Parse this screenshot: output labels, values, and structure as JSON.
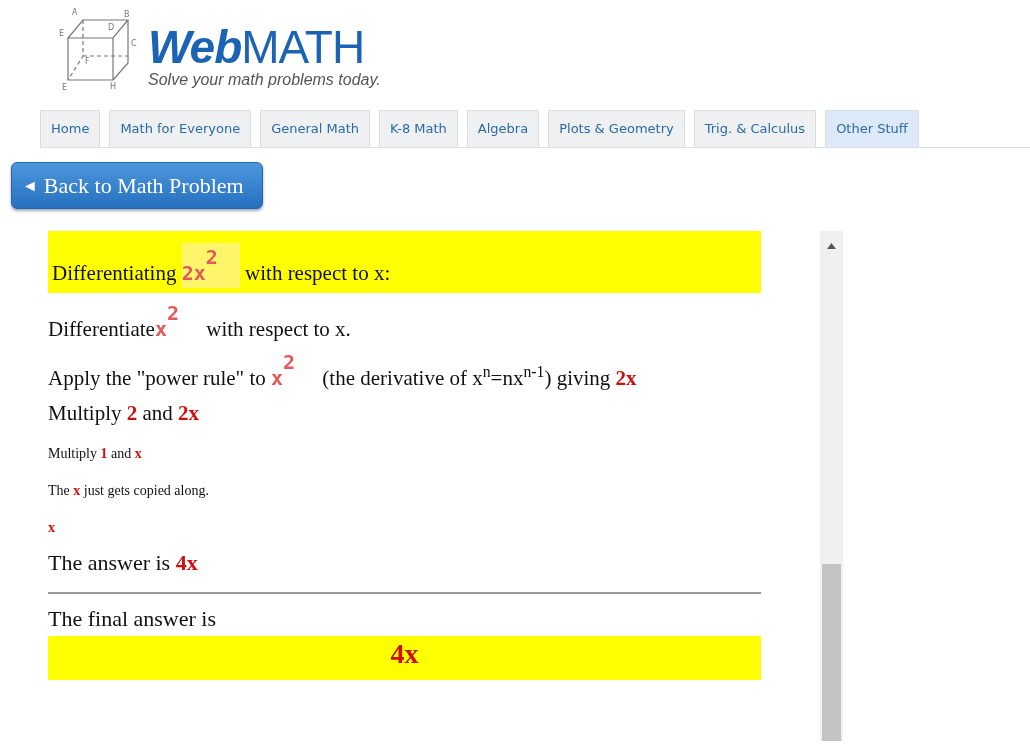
{
  "logo": {
    "vertex_labels": [
      "A",
      "B",
      "E",
      "D",
      "C",
      "F",
      "E",
      "H"
    ],
    "title_italic": "Web",
    "title_upright": "MATH",
    "tagline": "Solve your math problems today."
  },
  "tabs": [
    {
      "label": "Home",
      "selected": false
    },
    {
      "label": "Math for Everyone",
      "selected": false
    },
    {
      "label": "General Math",
      "selected": false
    },
    {
      "label": "K-8 Math",
      "selected": false
    },
    {
      "label": "Algebra",
      "selected": false
    },
    {
      "label": "Plots & Geometry",
      "selected": false
    },
    {
      "label": "Trig. & Calculus",
      "selected": false
    },
    {
      "label": "Other Stuff",
      "selected": true
    }
  ],
  "back_button": {
    "arrow": "◄",
    "label": "Back to Math Problem"
  },
  "steps": [
    {
      "kind": "header",
      "segments": [
        {
          "kind": "text",
          "text": "Differentiating "
        },
        {
          "kind": "expression",
          "text": "2x",
          "exponent": "2"
        },
        {
          "kind": "text",
          "text": " with respect to x:"
        }
      ]
    },
    {
      "kind": "line",
      "segments": [
        {
          "kind": "text",
          "text": "Differentiate"
        },
        {
          "kind": "expression",
          "text": "x",
          "exponent": "2"
        },
        {
          "kind": "text",
          "text": " with respect to x."
        }
      ]
    },
    {
      "kind": "line",
      "segments": [
        {
          "kind": "text",
          "text": "Apply the \"power rule\" to "
        },
        {
          "kind": "expression",
          "text": "x",
          "exponent": "2"
        },
        {
          "kind": "text",
          "text": " (the derivative of x$^{n}$=nx$^{n-1}$) giving "
        },
        {
          "kind": "term",
          "text": "2x"
        }
      ]
    },
    {
      "kind": "line",
      "segments": [
        {
          "kind": "text",
          "text": "Multiply "
        },
        {
          "kind": "term",
          "text": "2"
        },
        {
          "kind": "text",
          "text": " and "
        },
        {
          "kind": "term",
          "text": "2x"
        }
      ]
    },
    {
      "kind": "small",
      "segments": [
        {
          "kind": "text",
          "text": "Multiply "
        },
        {
          "kind": "term",
          "text": "1"
        },
        {
          "kind": "text",
          "text": " and "
        },
        {
          "kind": "term",
          "text": "x"
        }
      ]
    },
    {
      "kind": "small",
      "segments": [
        {
          "kind": "text",
          "text": "The "
        },
        {
          "kind": "term",
          "text": "x"
        },
        {
          "kind": "text",
          "text": " just gets copied along."
        }
      ]
    },
    {
      "kind": "small",
      "segments": [
        {
          "kind": "term",
          "text": "x"
        }
      ]
    },
    {
      "kind": "answer",
      "segments": [
        {
          "kind": "text",
          "text": "The answer is "
        },
        {
          "kind": "term",
          "text": "4x"
        }
      ]
    },
    {
      "kind": "rule"
    },
    {
      "kind": "answer",
      "segments": [
        {
          "kind": "text",
          "text": "The final answer is"
        }
      ]
    },
    {
      "kind": "final",
      "segments": [
        {
          "kind": "term",
          "text": "4x"
        }
      ]
    }
  ]
}
